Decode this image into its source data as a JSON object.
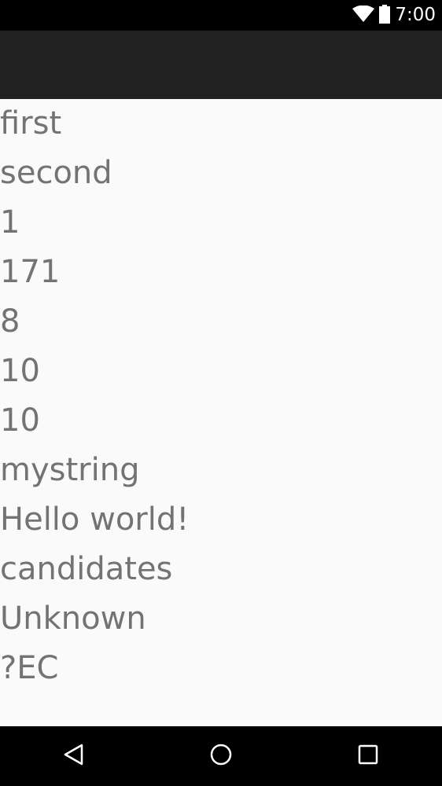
{
  "status_bar": {
    "time": "7:00",
    "icons": [
      "wifi-icon",
      "battery-icon"
    ]
  },
  "action_bar": {
    "title": ""
  },
  "list": {
    "items": [
      "first",
      "second",
      "1",
      "171",
      "8",
      "10",
      "10",
      "mystring",
      "Hello world!",
      "candidates",
      "Unknown",
      "?EC"
    ]
  },
  "nav_bar": {
    "buttons": [
      "back-icon",
      "home-icon",
      "recents-icon"
    ]
  },
  "colors": {
    "status_bar": "#000000",
    "action_bar": "#212121",
    "background": "#fafafa",
    "text": "#737373",
    "nav_bar": "#000000"
  }
}
